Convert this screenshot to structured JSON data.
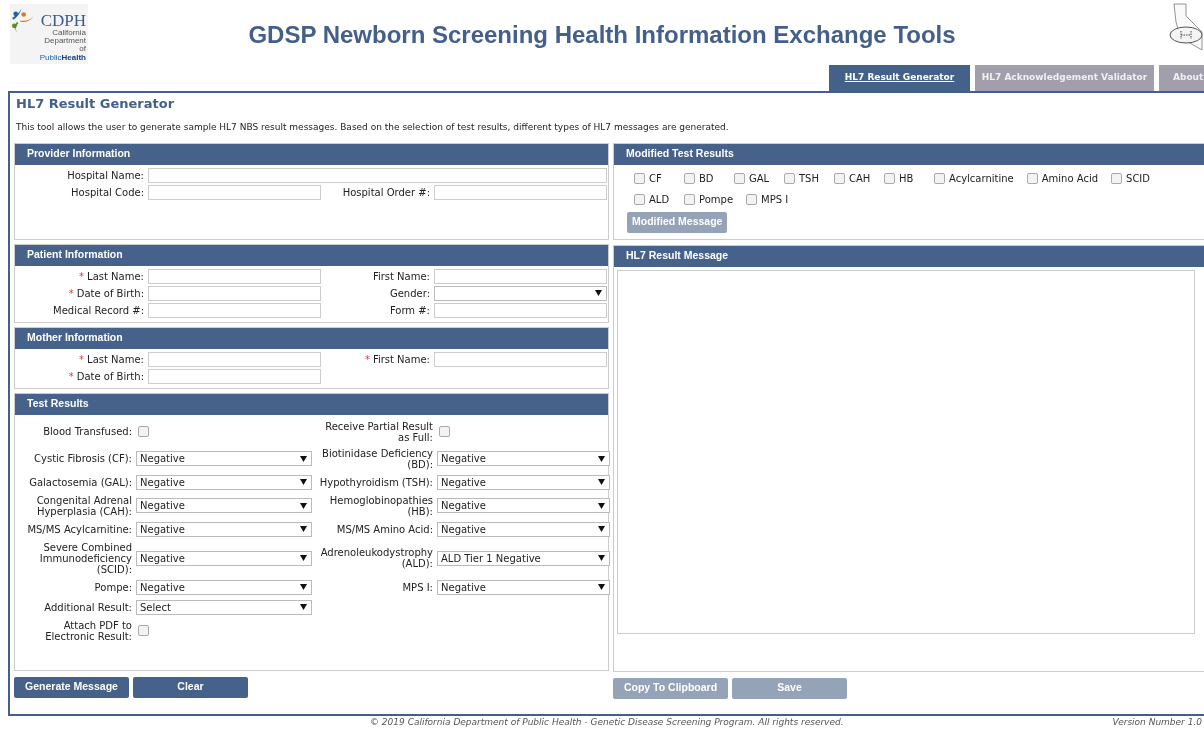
{
  "header": {
    "logo": {
      "letters": "CDPH",
      "subtitle": "California Department of",
      "tagline_first": "Public",
      "tagline_second": "Health"
    },
    "title": "GDSP Newborn Screening Health Information Exchange Tools"
  },
  "tabs": [
    {
      "label": "HL7 Result Generator",
      "selected": true
    },
    {
      "label": "HL7 Acknowledgement Validator",
      "selected": false
    },
    {
      "label": "About",
      "selected": false
    }
  ],
  "page": {
    "title": "HL7 Result Generator",
    "description": "This tool allows the user to generate sample HL7 NBS result messages. Based on the selection of test results, different types of HL7 messages are generated."
  },
  "required_marker": "*",
  "left_sections": [
    {
      "title": "Provider Information",
      "kind": "form",
      "rows": [
        [
          {
            "label": "Hospital Name:",
            "kind": "text",
            "required": false,
            "wide": true
          }
        ],
        [
          {
            "label": "Hospital Code:",
            "kind": "text",
            "required": false
          },
          {
            "label": "Hospital Order #:",
            "kind": "text",
            "required": false
          }
        ]
      ]
    },
    {
      "title": "Patient Information",
      "kind": "form",
      "rows": [
        [
          {
            "label": "Last Name:",
            "kind": "text",
            "required": true
          },
          {
            "label": "First Name:",
            "kind": "text",
            "required": false
          }
        ],
        [
          {
            "label": "Date of Birth:",
            "kind": "text",
            "required": true
          },
          {
            "label": "Gender:",
            "kind": "select",
            "required": false
          }
        ],
        [
          {
            "label": "Medical Record #:",
            "kind": "text",
            "required": false
          },
          {
            "label": "Form #:",
            "kind": "text",
            "required": false
          }
        ]
      ]
    },
    {
      "title": "Mother Information",
      "kind": "form",
      "rows": [
        [
          {
            "label": "Last Name:",
            "kind": "text",
            "required": true
          },
          {
            "label": "First Name:",
            "kind": "text",
            "required": true
          }
        ],
        [
          {
            "label": "Date of Birth:",
            "kind": "text",
            "required": true
          }
        ]
      ]
    },
    {
      "title": "Test Results",
      "kind": "tests",
      "rows": [
        [
          {
            "label": "Blood Transfused:",
            "kind": "checkbox",
            "required": false,
            "checked": false
          },
          {
            "label": "Receive Partial Result as Full:",
            "kind": "checkbox",
            "required": false,
            "checked": false
          }
        ],
        [
          {
            "label": "Cystic Fibrosis (CF):",
            "kind": "select",
            "required": false,
            "value": "Negative"
          },
          {
            "label": "Biotinidase Deficiency (BD):",
            "kind": "select",
            "required": false,
            "value": "Negative"
          }
        ],
        [
          {
            "label": "Galactosemia (GAL):",
            "kind": "select",
            "required": false,
            "value": "Negative"
          },
          {
            "label": "Hypothyroidism (TSH):",
            "kind": "select",
            "required": false,
            "value": "Negative"
          }
        ],
        [
          {
            "label": "Congenital Adrenal Hyperplasia (CAH):",
            "kind": "select",
            "required": false,
            "value": "Negative"
          },
          {
            "label": "Hemoglobinopathies (HB):",
            "kind": "select",
            "required": false,
            "value": "Negative"
          }
        ],
        [
          {
            "label": "MS/MS Acylcarnitine:",
            "kind": "select",
            "required": false,
            "value": "Negative"
          },
          {
            "label": "MS/MS Amino Acid:",
            "kind": "select",
            "required": false,
            "value": "Negative"
          }
        ],
        [
          {
            "label": "Severe Combined Immunodeficiency (SCID):",
            "kind": "select",
            "required": false,
            "value": "Negative"
          },
          {
            "label": "Adrenoleukodystrophy (ALD):",
            "kind": "select",
            "required": false,
            "value": "ALD Tier 1 Negative"
          }
        ],
        [
          {
            "label": "Pompe:",
            "kind": "select",
            "required": false,
            "value": "Negative"
          },
          {
            "label": "MPS I:",
            "kind": "select",
            "required": false,
            "value": "Negative"
          }
        ],
        [
          {
            "label": "Additional Result:",
            "kind": "select",
            "required": false,
            "value": "Select"
          }
        ],
        [
          {
            "label": "Attach PDF to Electronic Result:",
            "kind": "checkbox",
            "required": false,
            "checked": false
          }
        ]
      ]
    }
  ],
  "left_buttons": [
    {
      "label": "Generate Message",
      "disabled": false
    },
    {
      "label": "Clear",
      "disabled": false
    }
  ],
  "modified_tests": {
    "title": "Modified Test Results",
    "options": [
      {
        "label": "CF",
        "checked": false
      },
      {
        "label": "BD",
        "checked": false
      },
      {
        "label": "GAL",
        "checked": false
      },
      {
        "label": "TSH",
        "checked": false
      },
      {
        "label": "CAH",
        "checked": false
      },
      {
        "label": "HB",
        "checked": false
      },
      {
        "label": "Acylcarnitine",
        "checked": false
      },
      {
        "label": "Amino Acid",
        "checked": false
      },
      {
        "label": "SCID",
        "checked": false
      },
      {
        "label": "ALD",
        "checked": false
      },
      {
        "label": "Pompe",
        "checked": false
      },
      {
        "label": "MPS I",
        "checked": false
      }
    ],
    "button": {
      "label": "Modified Message",
      "disabled": true
    }
  },
  "result_message": {
    "title": "HL7 Result Message"
  },
  "right_buttons": [
    {
      "label": "Copy To Clipboard",
      "disabled": true
    },
    {
      "label": "Save",
      "disabled": true
    }
  ],
  "footer": {
    "copyright": "© 2019 California Department of Public Health - Genetic Disease Screening Program. All rights reserved.",
    "version": "Version Number 1.0"
  }
}
